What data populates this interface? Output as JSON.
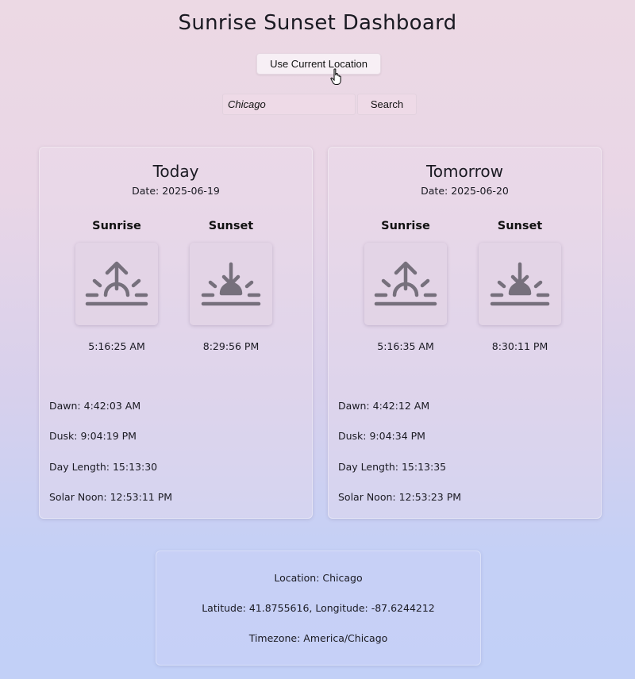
{
  "header": {
    "title": "Sunrise Sunset Dashboard",
    "location_button_label": "Use Current Location"
  },
  "search": {
    "value": "Chicago",
    "button_label": "Search"
  },
  "colors": {
    "icon": "#76707c",
    "text": "#1a1a22"
  },
  "today": {
    "title": "Today",
    "date": "Date: 2025-06-19",
    "sunrise_label": "Sunrise",
    "sunset_label": "Sunset",
    "sunrise_icon": "sunrise-icon",
    "sunset_icon": "sunset-icon",
    "sunrise_time": "5:16:25 AM",
    "sunset_time": "8:29:56 PM",
    "dawn": "Dawn: 4:42:03 AM",
    "dusk": "Dusk: 9:04:19 PM",
    "day_length": "Day Length: 15:13:30",
    "solar_noon": "Solar Noon: 12:53:11 PM"
  },
  "tomorrow": {
    "title": "Tomorrow",
    "date": "Date: 2025-06-20",
    "sunrise_label": "Sunrise",
    "sunset_label": "Sunset",
    "sunrise_icon": "sunrise-icon",
    "sunset_icon": "sunset-icon",
    "sunrise_time": "5:16:35 AM",
    "sunset_time": "8:30:11 PM",
    "dawn": "Dawn: 4:42:12 AM",
    "dusk": "Dusk: 9:04:34 PM",
    "day_length": "Day Length: 15:13:35",
    "solar_noon": "Solar Noon: 12:53:23 PM"
  },
  "location_info": {
    "location": "Location: Chicago",
    "coordinates": "Latitude: 41.8755616, Longitude: -87.6244212",
    "timezone": "Timezone: America/Chicago"
  }
}
